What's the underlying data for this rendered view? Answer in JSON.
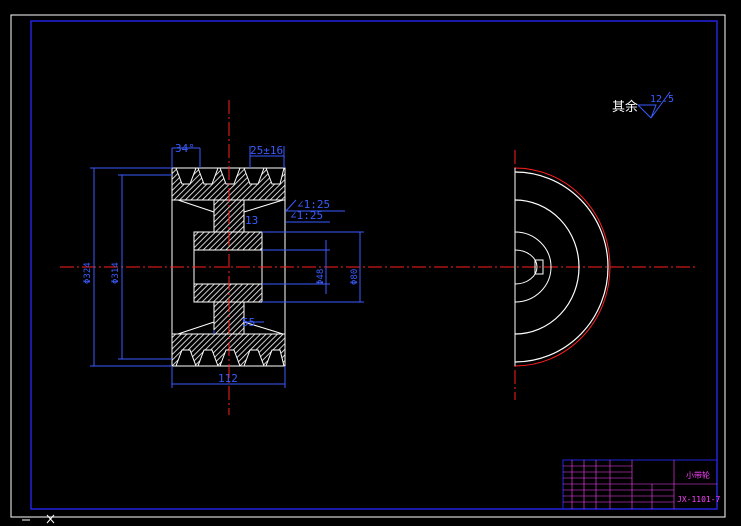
{
  "drawing": {
    "note_text": "其余",
    "roughness": "12.5",
    "dimensions": {
      "groove_angle": "34°",
      "groove_pitch": "25±16",
      "slope_top": "∠1:25",
      "slope_bottom": "∠1:25",
      "chamfer": "13",
      "outer_diameter": "Φ324",
      "pitch_diameter": "Φ314",
      "bore_diameter": "Φ48",
      "hub_diameter": "Φ80",
      "hub_width": "55",
      "overall_width": "112"
    },
    "title_block": {
      "part_name": "小带轮",
      "drawing_code": "JX-1101-7"
    }
  },
  "colors": {
    "background": "#000000",
    "border": "#2222dd",
    "outline": "#ffffff",
    "dimension": "#3a5cff",
    "centerline": "#ff2020",
    "title_text": "#ff40ff"
  }
}
